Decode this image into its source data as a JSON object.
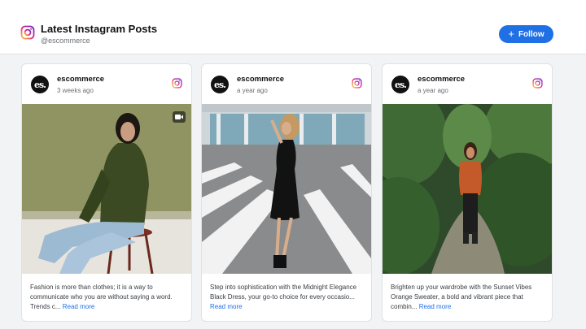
{
  "header": {
    "title": "Latest Instagram Posts",
    "handle": "@escommerce",
    "follow_label": "Follow"
  },
  "colors": {
    "accent": "#1f6fe5",
    "background": "#f2f3f5",
    "card": "#ffffff"
  },
  "posts": [
    {
      "username": "escommerce",
      "avatar_text": "es.",
      "time": "3 weeks ago",
      "media_icon": "video-icon",
      "caption": "Fashion is more than clothes; it is a way to communicate who you are without saying a word. Trends c...",
      "read_more": "Read more"
    },
    {
      "username": "escommerce",
      "avatar_text": "es.",
      "time": "a year ago",
      "caption": "Step into sophistication with the Midnight Elegance Black Dress, your go-to choice for every occasio...",
      "read_more": "Read more"
    },
    {
      "username": "escommerce",
      "avatar_text": "es.",
      "time": "a year ago",
      "caption": "Brighten up your wardrobe with the Sunset Vibes Orange Sweater, a bold and vibrant piece that combin...",
      "read_more": "Read more"
    }
  ]
}
